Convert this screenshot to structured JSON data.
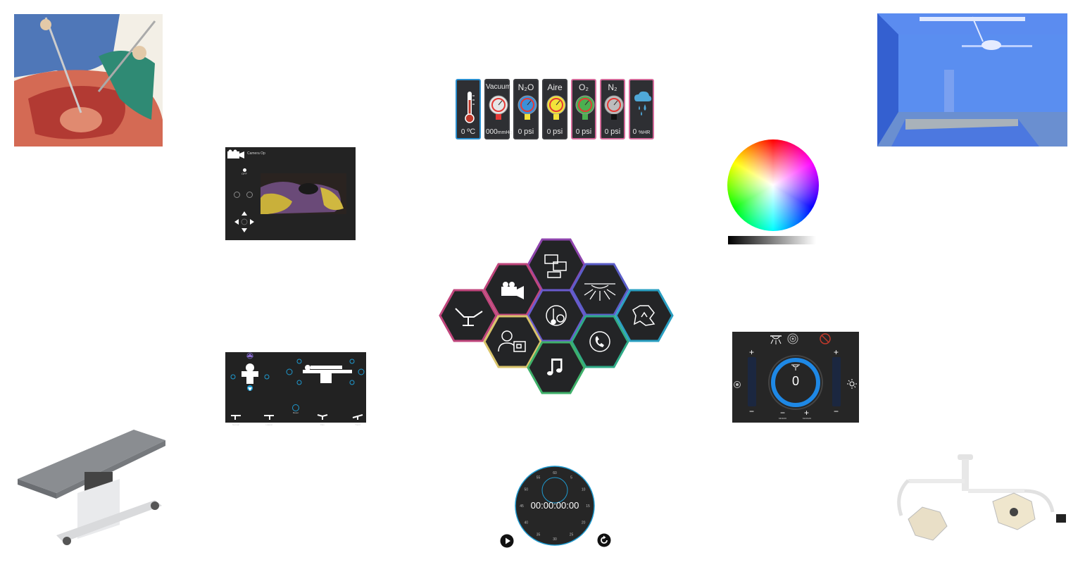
{
  "gases": [
    {
      "name": "",
      "value": "0",
      "unit": "ºC",
      "border": "#2a8fd0",
      "icon": "thermometer-icon",
      "color": "#c0392b"
    },
    {
      "name": "Vacuum",
      "value": "000",
      "unit": "mmHg",
      "border": "#3a3b3f",
      "color": "#e53935"
    },
    {
      "name": "N₂O",
      "value": "0",
      "unit": "psi",
      "border": "#3a3b3f",
      "color": "#3b8fd9"
    },
    {
      "name": "Aire",
      "value": "0",
      "unit": "psi",
      "border": "#3a3b3f",
      "color": "#f2e23a"
    },
    {
      "name": "O₂",
      "value": "0",
      "unit": "psi",
      "border": "#d46a9a",
      "color": "#4caf50"
    },
    {
      "name": "N₂",
      "value": "0",
      "unit": "psi",
      "border": "#d46a9a",
      "color": "#bdbdbd"
    },
    {
      "name": "",
      "value": "0",
      "unit": "%HR",
      "border": "#d46a9a",
      "icon": "humidity-icon",
      "color": "#4fa8d8"
    }
  ],
  "camera_panel": {
    "title": "Camera Op",
    "off_label": "OFF"
  },
  "table_panel": {
    "positions": [
      "Normal",
      "Lateral",
      "Reset",
      "Flex",
      "Trend"
    ]
  },
  "hex_menu": {
    "items": [
      {
        "id": "monitors",
        "icon": "monitors-icon",
        "color": "#8e44ad"
      },
      {
        "id": "camera",
        "icon": "camera-icon",
        "color": "#c0467c"
      },
      {
        "id": "lights",
        "icon": "ceiling-light-icon",
        "color": "#5b5ec9"
      },
      {
        "id": "table",
        "icon": "operating-table-icon",
        "color": "#c0467c"
      },
      {
        "id": "gases",
        "icon": "gases-icon",
        "color": "#6a5acd"
      },
      {
        "id": "ambient",
        "icon": "ambient-icon",
        "color": "#2a9fc2"
      },
      {
        "id": "staff",
        "icon": "staff-id-icon",
        "color": "#d8c36a"
      },
      {
        "id": "phone",
        "icon": "phone-icon",
        "color": "#2faa87"
      },
      {
        "id": "music",
        "icon": "music-icon",
        "color": "#3fb06a"
      }
    ]
  },
  "light_panel": {
    "intensity": "0",
    "minus_label": "MINIMO",
    "plus_label": "MAXIMO",
    "plus": "+",
    "minus": "−"
  },
  "timer": {
    "display": "00:00:00:00",
    "dial_labels": [
      "60",
      "5",
      "10",
      "15",
      "20",
      "25",
      "30",
      "35",
      "40",
      "45",
      "50",
      "55"
    ]
  }
}
